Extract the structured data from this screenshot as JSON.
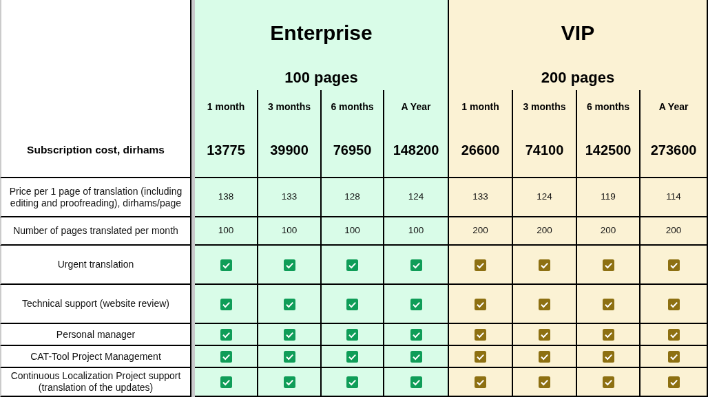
{
  "header": {
    "label": "Subscription cost, dirhams"
  },
  "plans": [
    {
      "name": "Enterprise",
      "pages": "100 pages",
      "color": "#d9fce8",
      "periods": [
        {
          "label": "1 month",
          "price": "13775"
        },
        {
          "label": "3 months",
          "price": "39900"
        },
        {
          "label": "6 months",
          "price": "76950"
        },
        {
          "label": "A Year",
          "price": "148200"
        }
      ]
    },
    {
      "name": "VIP",
      "pages": "200 pages",
      "color": "#fbf2d4",
      "periods": [
        {
          "label": "1 month",
          "price": "26600"
        },
        {
          "label": "3 months",
          "price": "74100"
        },
        {
          "label": "6 months",
          "price": "142500"
        },
        {
          "label": "A Year",
          "price": "273600"
        }
      ]
    }
  ],
  "features": [
    {
      "label": "Price per 1 page of translation (including editing and proofreading), dirhams/page",
      "kind": "text",
      "cells": [
        {
          "text": "138"
        },
        {
          "text": "133"
        },
        {
          "text": "128"
        },
        {
          "text": "124"
        },
        {
          "text": "133"
        },
        {
          "text": "124"
        },
        {
          "text": "119"
        },
        {
          "text": "114"
        }
      ]
    },
    {
      "label": "Number of pages translated per month",
      "kind": "text",
      "cells": [
        {
          "text": "100"
        },
        {
          "text": "100"
        },
        {
          "text": "100"
        },
        {
          "text": "100"
        },
        {
          "text": "200"
        },
        {
          "text": "200"
        },
        {
          "text": "200"
        },
        {
          "text": "200"
        }
      ]
    },
    {
      "label": "Urgent translation",
      "kind": "check",
      "cells": [
        {
          "checked": true,
          "color": "#0f9d58"
        },
        {
          "checked": true,
          "color": "#0f9d58"
        },
        {
          "checked": true,
          "color": "#0f9d58"
        },
        {
          "checked": true,
          "color": "#0f9d58"
        },
        {
          "checked": true,
          "color": "#8d7012"
        },
        {
          "checked": true,
          "color": "#8d7012"
        },
        {
          "checked": true,
          "color": "#8d7012"
        },
        {
          "checked": true,
          "color": "#8d7012"
        }
      ]
    },
    {
      "label": "Technical support (website review)",
      "kind": "check",
      "cells": [
        {
          "checked": true,
          "color": "#0f9d58"
        },
        {
          "checked": true,
          "color": "#0f9d58"
        },
        {
          "checked": true,
          "color": "#0f9d58"
        },
        {
          "checked": true,
          "color": "#0f9d58"
        },
        {
          "checked": true,
          "color": "#8d7012"
        },
        {
          "checked": true,
          "color": "#8d7012"
        },
        {
          "checked": true,
          "color": "#8d7012"
        },
        {
          "checked": true,
          "color": "#8d7012"
        }
      ]
    },
    {
      "label": "Personal manager",
      "kind": "check",
      "cells": [
        {
          "checked": true,
          "color": "#0f9d58"
        },
        {
          "checked": true,
          "color": "#0f9d58"
        },
        {
          "checked": true,
          "color": "#0f9d58"
        },
        {
          "checked": true,
          "color": "#0f9d58"
        },
        {
          "checked": true,
          "color": "#8d7012"
        },
        {
          "checked": true,
          "color": "#8d7012"
        },
        {
          "checked": true,
          "color": "#8d7012"
        },
        {
          "checked": true,
          "color": "#8d7012"
        }
      ]
    },
    {
      "label": "CAT-Tool Project Management",
      "kind": "check",
      "cells": [
        {
          "checked": true,
          "color": "#0f9d58"
        },
        {
          "checked": true,
          "color": "#0f9d58"
        },
        {
          "checked": true,
          "color": "#0f9d58"
        },
        {
          "checked": true,
          "color": "#0f9d58"
        },
        {
          "checked": true,
          "color": "#8d7012"
        },
        {
          "checked": true,
          "color": "#8d7012"
        },
        {
          "checked": true,
          "color": "#8d7012"
        },
        {
          "checked": true,
          "color": "#8d7012"
        }
      ]
    },
    {
      "label": "Continuous Localization Project support (translation of the updates)",
      "kind": "check",
      "cells": [
        {
          "checked": true,
          "color": "#0f9d58"
        },
        {
          "checked": true,
          "color": "#0f9d58"
        },
        {
          "checked": true,
          "color": "#0f9d58"
        },
        {
          "checked": true,
          "color": "#0f9d58"
        },
        {
          "checked": true,
          "color": "#8d7012"
        },
        {
          "checked": true,
          "color": "#8d7012"
        },
        {
          "checked": true,
          "color": "#8d7012"
        },
        {
          "checked": true,
          "color": "#8d7012"
        }
      ]
    }
  ]
}
